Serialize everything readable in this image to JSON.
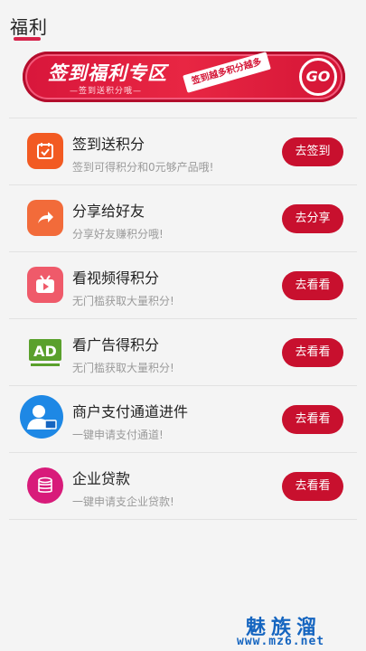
{
  "header": {
    "title": "福利"
  },
  "banner": {
    "title": "签到福利专区",
    "subtitle": "—签到送积分哦—",
    "tag": "签到越多积分越多",
    "go_label": "GO"
  },
  "items": [
    {
      "icon": "calendar-check-icon",
      "color": "#f25a22",
      "title": "签到送积分",
      "subtitle": "签到可得积分和0元够产品哦!",
      "button": "去签到"
    },
    {
      "icon": "share-arrow-icon",
      "color": "#f26b3a",
      "title": "分享给好友",
      "subtitle": "分享好友赚积分哦!",
      "button": "去分享"
    },
    {
      "icon": "tv-play-icon",
      "color": "#ef5a6a",
      "title": "看视频得积分",
      "subtitle": "无门槛获取大量积分!",
      "button": "去看看"
    },
    {
      "icon": "ad-board-icon",
      "color": "#5aa02c",
      "title": "看广告得积分",
      "subtitle": "无门槛获取大量积分!",
      "button": "去看看"
    },
    {
      "icon": "merchant-user-icon",
      "color": "#1e88e5",
      "title": "商户支付通道进件",
      "subtitle": "一键申请支付通道!",
      "button": "去看看"
    },
    {
      "icon": "coins-stack-icon",
      "color": "#d81b7a",
      "title": "企业贷款",
      "subtitle": "一键申请支企业贷款!",
      "button": "去看看"
    }
  ],
  "watermark": {
    "name": "魅族溜",
    "url": "www.mz6.net"
  },
  "colors": {
    "accent": "#c8102e",
    "divider": "#e2e2e2",
    "background": "#f4f4f4"
  }
}
